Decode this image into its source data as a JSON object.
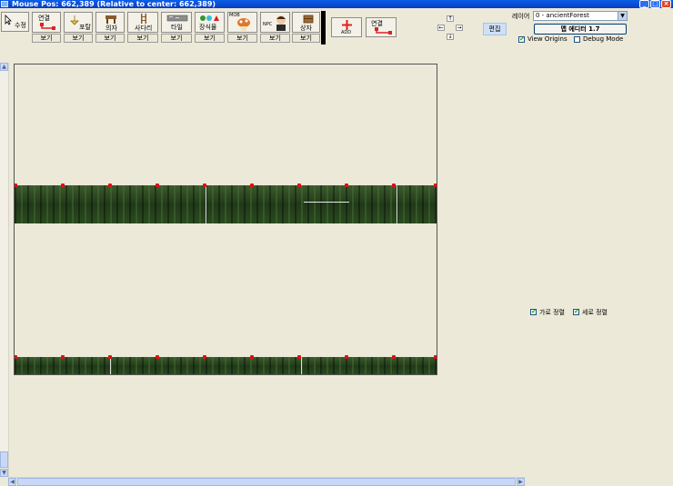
{
  "window": {
    "title": "Mouse Pos: 662,389 (Relative to center: 662,389)",
    "controls": [
      "_",
      "□",
      "×"
    ]
  },
  "toolbar": {
    "select_tool": {
      "label": "수정",
      "icon": "cursor-arrow-icon"
    },
    "tools": [
      {
        "label": "연결",
        "icon": "connection-icon",
        "sub": "보기"
      },
      {
        "label": "포탈",
        "icon": "portal-icon",
        "sub": "보기"
      },
      {
        "label": "의자",
        "icon": "chair-icon",
        "sub": "보기"
      },
      {
        "label": "사다리",
        "icon": "ladder-icon",
        "sub": "보기"
      },
      {
        "label": "타일",
        "icon": "tile-icon",
        "sub": "보기"
      },
      {
        "label": "장식물",
        "icon": "decoration-icon",
        "sub": "보기"
      },
      {
        "label": "MOB",
        "icon": "mob-icon",
        "sub": "보기"
      },
      {
        "label": "NPC",
        "icon": "npc-icon",
        "sub": "보기"
      },
      {
        "label": "상자",
        "icon": "box-icon",
        "sub": "보기"
      }
    ],
    "add": {
      "label": "ADD",
      "icon": "plus-icon"
    },
    "connect": {
      "label": "연결",
      "icon": "connection-icon"
    },
    "arrows": {
      "up": "↑",
      "left": "←",
      "right": "→",
      "down": "↓"
    },
    "edit_label": "편집"
  },
  "layer_panel": {
    "label": "레이어",
    "selected": "0 - ancientForest",
    "map_editor_button": "맵 에디터 1.7",
    "view_origins": {
      "label": "View Origins",
      "checked": true
    },
    "debug_mode": {
      "label": "Debug Mode",
      "checked": false
    }
  },
  "align_panel": {
    "horizontal": {
      "label": "가로 정렬",
      "checked": true
    },
    "vertical": {
      "label": "세로 정렬",
      "checked": true
    }
  },
  "colors": {
    "background": "#ece9d8",
    "title_bar": "#0a5ee8",
    "foothold_node": "#e01010",
    "foliage": "#2b4a20"
  }
}
